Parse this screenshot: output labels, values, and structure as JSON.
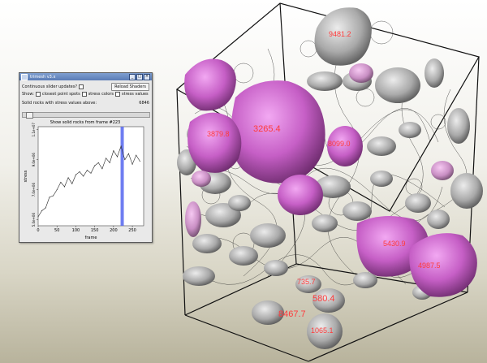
{
  "window": {
    "title": "trimesh v3.x",
    "controls": [
      "_",
      "□",
      "×"
    ]
  },
  "controls": {
    "continuous_label": "Continuous slider updates?",
    "reload_button": "Reload Shaders",
    "show_label": "Show:",
    "closest_label": "closest point spots",
    "stress_colors_label": "stress colors",
    "stress_values_label": "stress values",
    "solid_rocks_label": "Solid rocks with stress values above:",
    "solid_rocks_value": "6846",
    "show_frame_label": "Show solid rocks from frame #223"
  },
  "chart_data": {
    "type": "line",
    "title": "",
    "xlabel": "frame",
    "ylabel": "stress",
    "xlim": [
      0,
      280
    ],
    "ylim": [
      4600000.0,
      11200000.0
    ],
    "xticks": [
      "0",
      "50",
      "100",
      "150",
      "200",
      "250"
    ],
    "xtick_values": [
      0,
      50,
      100,
      150,
      200,
      250
    ],
    "yticks": [
      "5.0e+06",
      "7.0e+06",
      "9.0e+06",
      "1.1e+07"
    ],
    "ytick_values": [
      5000000.0,
      7000000.0,
      9000000.0,
      11000000.0
    ],
    "highlight_frame": 223,
    "highlight_color": "#5566ee",
    "series": [
      {
        "color": "#222222",
        "x": [
          0,
          10,
          20,
          30,
          40,
          50,
          60,
          70,
          80,
          90,
          100,
          110,
          120,
          130,
          140,
          150,
          160,
          170,
          180,
          190,
          200,
          210,
          220,
          230,
          240,
          250,
          260,
          270
        ],
        "values": [
          5200000.0,
          5600000.0,
          5800000.0,
          6500000.0,
          6600000.0,
          7000000.0,
          7500000.0,
          7200000.0,
          7800000.0,
          7400000.0,
          8000000.0,
          8200000.0,
          7900000.0,
          8300000.0,
          8100000.0,
          8600000.0,
          8800000.0,
          8400000.0,
          9100000.0,
          8800000.0,
          9600000.0,
          9200000.0,
          9900000.0,
          9000000.0,
          9400000.0,
          8700000.0,
          9300000.0,
          8900000.0
        ]
      }
    ]
  },
  "rock_labels": [
    "3265.4",
    "8467.7",
    "1065.1",
    "580.4",
    "735.7",
    "8099.0",
    "4987.5",
    "3879.8",
    "9481.2",
    "5430.9"
  ]
}
